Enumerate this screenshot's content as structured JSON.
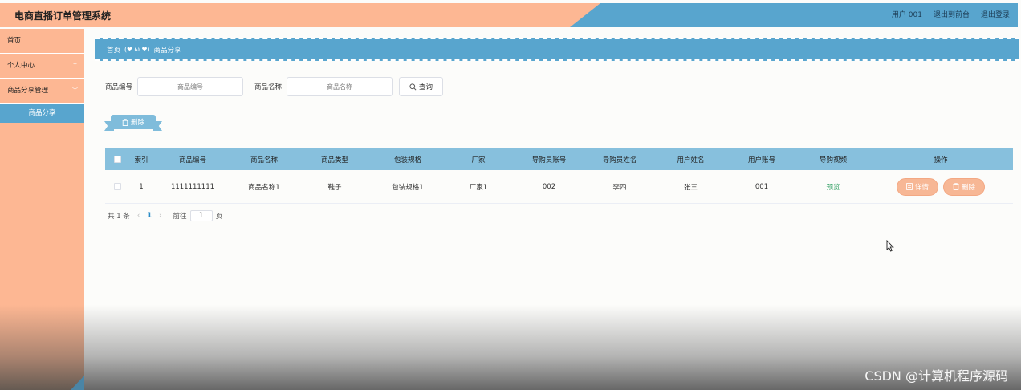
{
  "header": {
    "title": "电商直播订单管理系统",
    "user": "用户 001",
    "front": "退出到前台",
    "logout": "退出登录"
  },
  "sidebar": {
    "items": [
      {
        "label": "首页"
      },
      {
        "label": "个人中心"
      },
      {
        "label": "商品分享管理"
      }
    ],
    "sub_item": "商品分享"
  },
  "breadcrumb": {
    "home": "首页",
    "sep": "(❤ ω ❤)",
    "current": "商品分享"
  },
  "search": {
    "field1_label": "商品编号",
    "field1_placeholder": "商品编号",
    "field2_label": "商品名称",
    "field2_placeholder": "商品名称",
    "query_label": "查询"
  },
  "toolbar": {
    "delete_label": "删除"
  },
  "table": {
    "columns": [
      "索引",
      "商品编号",
      "商品名称",
      "商品类型",
      "包装规格",
      "厂家",
      "导购员账号",
      "导购员姓名",
      "用户姓名",
      "用户账号",
      "导购视频",
      "操作"
    ],
    "rows": [
      {
        "index": "1",
        "code": "1111111111",
        "name": "商品名称1",
        "type": "鞋子",
        "spec": "包装规格1",
        "maker": "厂家1",
        "guide_account": "002",
        "guide_name": "李四",
        "user_name": "张三",
        "user_account": "001",
        "video": "预览",
        "detail_label": "详情",
        "delete_label": "删除"
      }
    ]
  },
  "pagination": {
    "total": "共 1 条",
    "current_page": "1",
    "goto_label": "前往",
    "goto_value": "1",
    "page_unit": "页"
  },
  "watermark": "CSDN @计算机程序源码",
  "colors": {
    "accent_orange": "#fdb793",
    "accent_blue": "#58a5ce",
    "table_header": "#87c0dd",
    "video_link": "#3aa36a"
  }
}
